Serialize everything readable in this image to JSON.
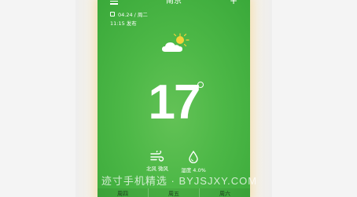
{
  "header": {
    "city": "南京",
    "menu_icon": "menu-icon",
    "add_icon": "add-icon"
  },
  "info": {
    "date": "04.24 / 周二",
    "publish_time": "11:15 发布"
  },
  "weather": {
    "icon": "partly-cloudy-icon",
    "temperature": "17",
    "wind_label": "北风 微风",
    "humidity_label": "湿度 4.0%"
  },
  "forecast": {
    "days": [
      "周四",
      "周五",
      "周六"
    ]
  },
  "watermark": "迹寸手机精选 · BYJSJXY.COM",
  "colors": {
    "background_green": "#4db847",
    "sun_yellow": "#f5d23a"
  }
}
